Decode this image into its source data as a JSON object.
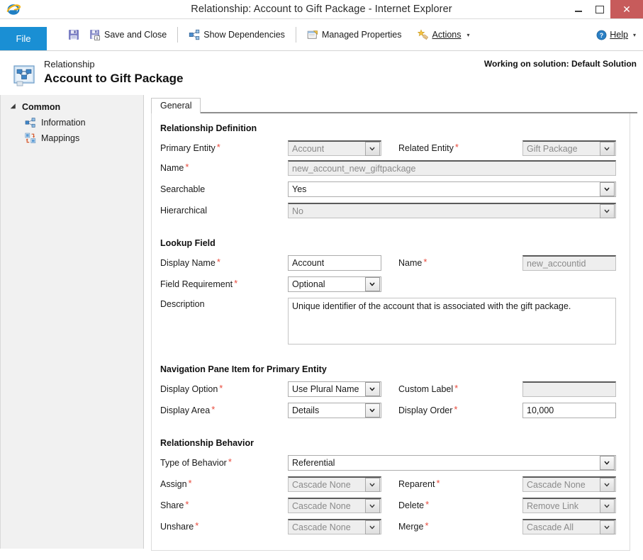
{
  "window": {
    "title": "Relationship: Account to Gift Package - Internet Explorer",
    "minimize_label": "–",
    "maximize_label": "❐",
    "close_label": "✕",
    "browser_icon": "internet-explorer-icon"
  },
  "ribbon": {
    "file_label": "File",
    "save_icon": "save-icon",
    "save_and_close_label": "Save and Close",
    "save_and_close_icon": "save-and-close-icon",
    "show_dependencies_label": "Show Dependencies",
    "show_dependencies_icon": "dependencies-icon",
    "managed_properties_label": "Managed Properties",
    "managed_properties_icon": "managed-properties-icon",
    "actions_label": "Actions",
    "actions_icon": "actions-star-icon",
    "help_label": "Help",
    "help_icon": "help-question-icon",
    "caret": "▾"
  },
  "header": {
    "subtitle": "Relationship",
    "title": "Account to Gift Package",
    "solution_note": "Working on solution: Default Solution",
    "entity_icon": "relationship-entity-icon"
  },
  "sidebar": {
    "group_label": "Common",
    "items": [
      {
        "label": "Information",
        "icon": "information-relationship-icon"
      },
      {
        "label": "Mappings",
        "icon": "mappings-icon"
      }
    ]
  },
  "tabs": [
    {
      "label": "General",
      "active": true
    }
  ],
  "form": {
    "sections": {
      "relationship_definition": {
        "title": "Relationship Definition",
        "primary_entity_label": "Primary Entity",
        "primary_entity_value": "Account",
        "related_entity_label": "Related Entity",
        "related_entity_value": "Gift Package",
        "name_label": "Name",
        "name_value": "new_account_new_giftpackage",
        "searchable_label": "Searchable",
        "searchable_value": "Yes",
        "hierarchical_label": "Hierarchical",
        "hierarchical_value": "No"
      },
      "lookup_field": {
        "title": "Lookup Field",
        "display_name_label": "Display Name",
        "display_name_value": "Account",
        "name_label": "Name",
        "name_value": "new_accountid",
        "field_requirement_label": "Field Requirement",
        "field_requirement_value": "Optional",
        "description_label": "Description",
        "description_value": "Unique identifier of the account that is associated with the gift package."
      },
      "navigation_pane": {
        "title": "Navigation Pane Item for Primary Entity",
        "display_option_label": "Display Option",
        "display_option_value": "Use Plural Name",
        "custom_label_label": "Custom Label",
        "custom_label_value": "",
        "display_area_label": "Display Area",
        "display_area_value": "Details",
        "display_order_label": "Display Order",
        "display_order_value": "10,000"
      },
      "relationship_behavior": {
        "title": "Relationship Behavior",
        "type_of_behavior_label": "Type of Behavior",
        "type_of_behavior_value": "Referential",
        "assign_label": "Assign",
        "assign_value": "Cascade None",
        "reparent_label": "Reparent",
        "reparent_value": "Cascade None",
        "share_label": "Share",
        "share_value": "Cascade None",
        "delete_label": "Delete",
        "delete_value": "Remove Link",
        "unshare_label": "Unshare",
        "unshare_value": "Cascade None",
        "merge_label": "Merge",
        "merge_value": "Cascade All"
      }
    },
    "required_marker": "*"
  },
  "colors": {
    "file_tab_blue": "#1a8fd4",
    "close_red": "#c75b5b",
    "required_red": "#e8483a",
    "sidebar_gray": "#f1f1f1"
  }
}
